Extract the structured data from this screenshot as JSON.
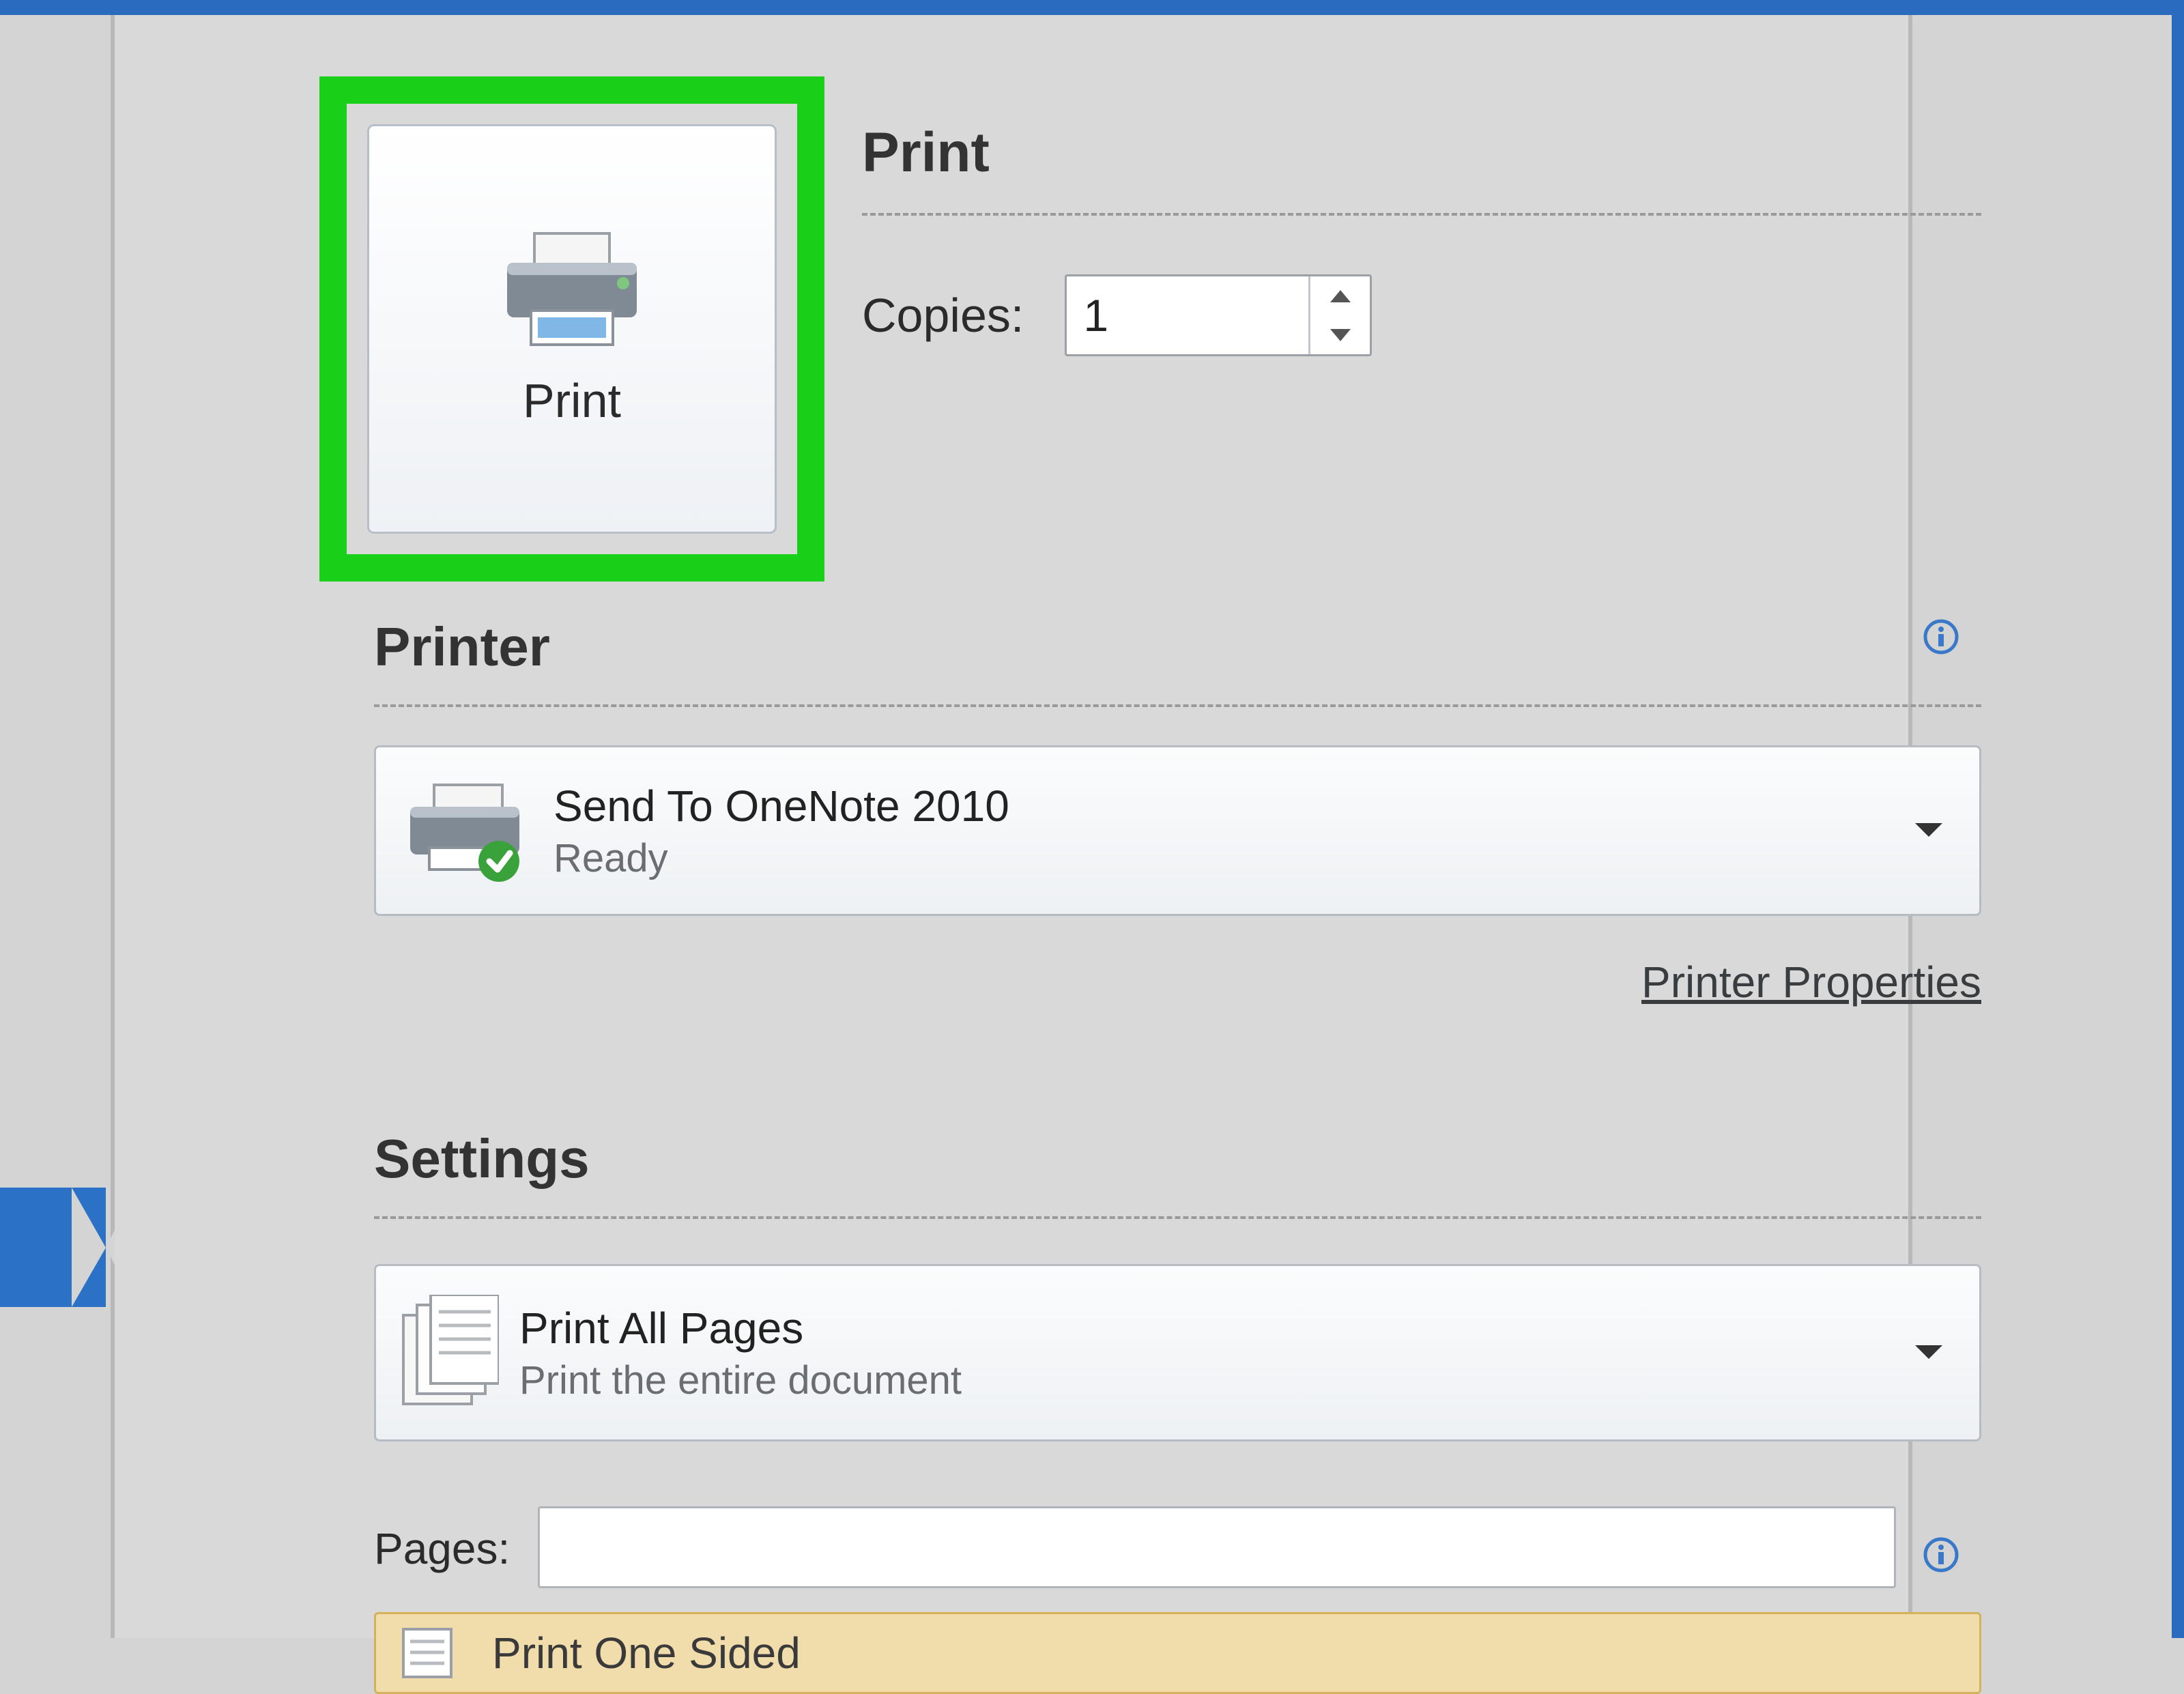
{
  "print": {
    "button_label": "Print",
    "heading": "Print",
    "copies_label": "Copies:",
    "copies_value": "1"
  },
  "printer": {
    "heading": "Printer",
    "selected_name": "Send To OneNote 2010",
    "selected_status": "Ready",
    "properties_link": "Printer Properties"
  },
  "settings": {
    "heading": "Settings",
    "range_title": "Print All Pages",
    "range_subtitle": "Print the entire document",
    "pages_label": "Pages:",
    "pages_value": "",
    "sided_title": "Print One Sided"
  }
}
